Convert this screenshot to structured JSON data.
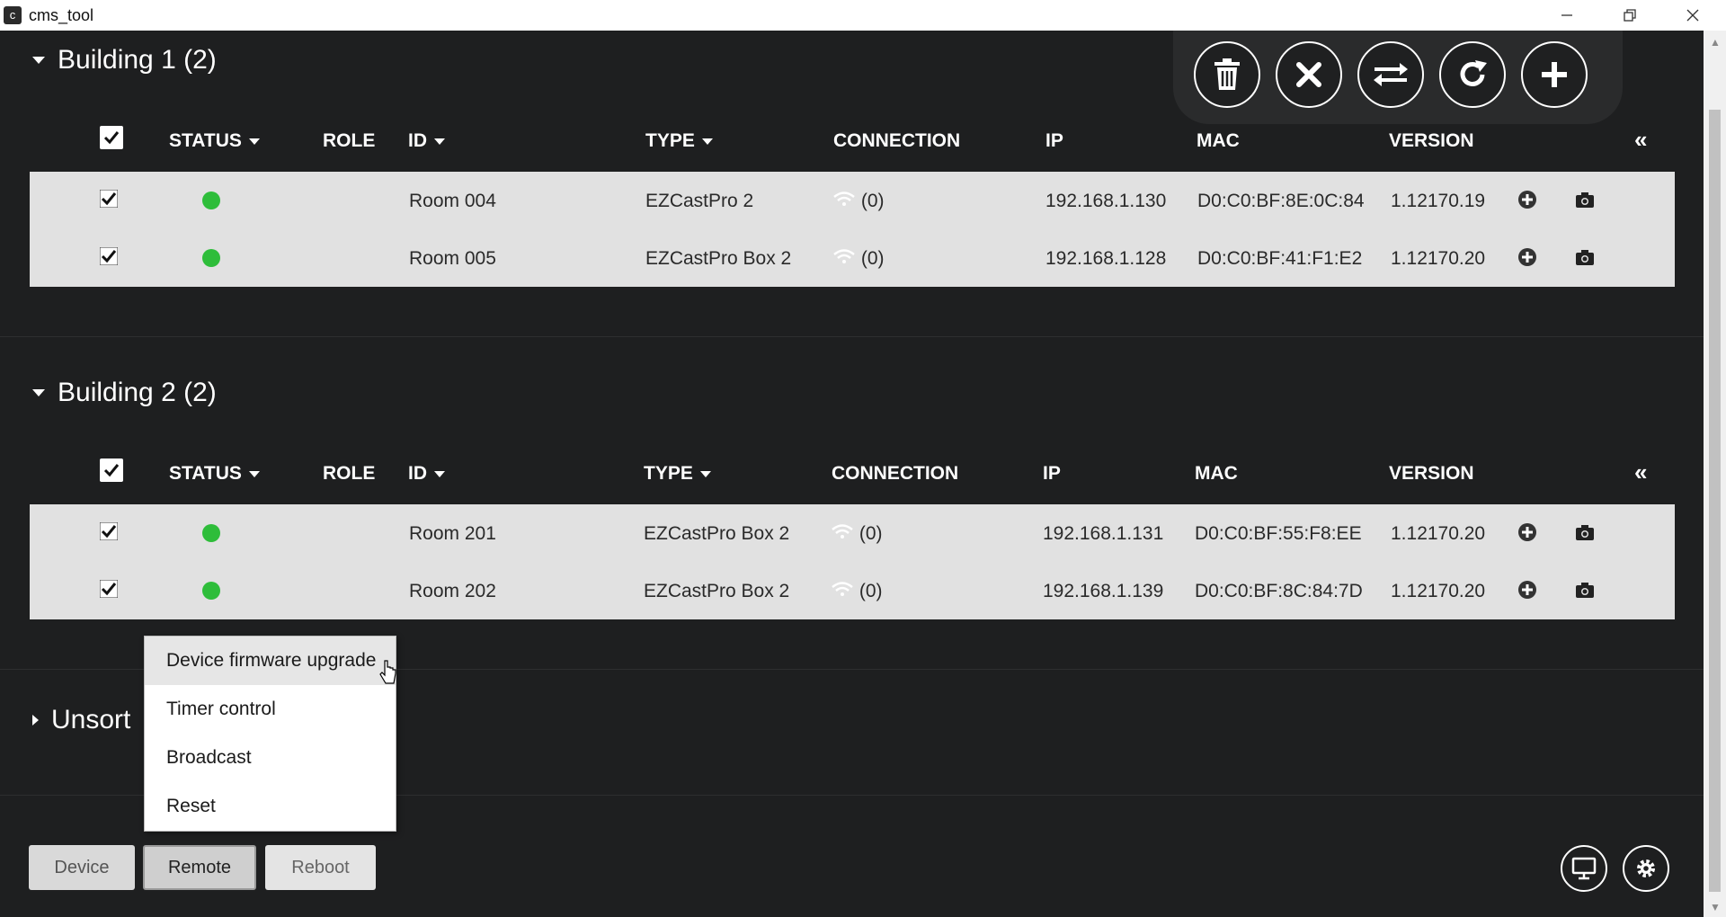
{
  "window": {
    "title": "cms_tool",
    "app_icon": "c"
  },
  "groups": [
    {
      "title": "Building 1 (2)",
      "header": {
        "status": "STATUS",
        "role": "ROLE",
        "id": "ID",
        "type": "TYPE",
        "connection": "CONNECTION",
        "ip": "IP",
        "mac": "MAC",
        "version": "VERSION",
        "collapse": "«"
      },
      "rows": [
        {
          "id": "Room 004",
          "type": "EZCastPro 2",
          "connection": "(0)",
          "ip": "192.168.1.130",
          "mac": "D0:C0:BF:8E:0C:84",
          "version": "1.12170.19"
        },
        {
          "id": "Room 005",
          "type": "EZCastPro Box 2",
          "connection": "(0)",
          "ip": "192.168.1.128",
          "mac": "D0:C0:BF:41:F1:E2",
          "version": "1.12170.20"
        }
      ]
    },
    {
      "title": "Building 2 (2)",
      "header": {
        "status": "STATUS",
        "role": "ROLE",
        "id": "ID",
        "type": "TYPE",
        "connection": "CONNECTION",
        "ip": "IP",
        "mac": "MAC",
        "version": "VERSION",
        "collapse": "«"
      },
      "rows": [
        {
          "id": "Room 201",
          "type": "EZCastPro Box 2",
          "connection": "(0)",
          "ip": "192.168.1.131",
          "mac": "D0:C0:BF:55:F8:EE",
          "version": "1.12170.20"
        },
        {
          "id": "Room 202",
          "type": "EZCastPro Box 2",
          "connection": "(0)",
          "ip": "192.168.1.139",
          "mac": "D0:C0:BF:8C:84:7D",
          "version": "1.12170.20"
        }
      ]
    }
  ],
  "unsorted": {
    "title": "Unsort"
  },
  "context_menu": {
    "items": [
      "Device firmware upgrade",
      "Timer control",
      "Broadcast",
      "Reset"
    ],
    "hovered_index": 0
  },
  "bottom_bar": {
    "device": "Device",
    "remote": "Remote",
    "reboot": "Reboot",
    "selected": "Remote"
  },
  "fab_icons": [
    "trash-icon",
    "close-icon",
    "swap-icon",
    "refresh-icon",
    "plus-icon"
  ],
  "colors": {
    "status_online": "#2ebd3a",
    "background": "#1e1f20",
    "row_bg": "#e1e1e1"
  }
}
